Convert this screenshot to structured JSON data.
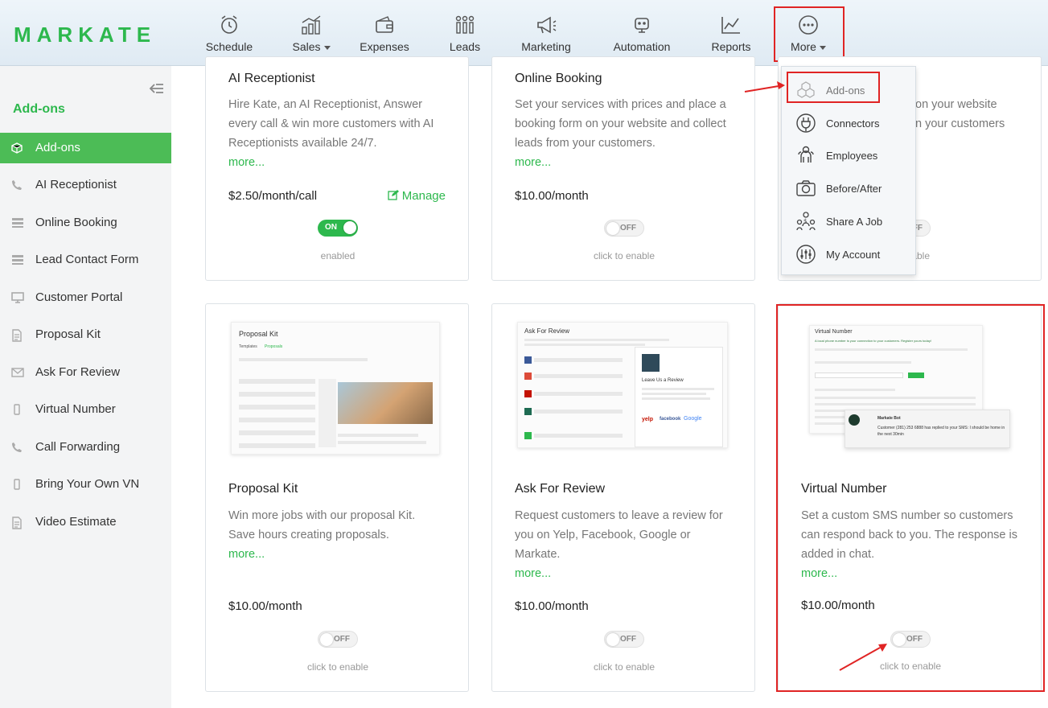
{
  "brand": {
    "name": "MARKATE",
    "accent": "#2db84d",
    "highlight": "#e02424"
  },
  "nav": {
    "schedule": "Schedule",
    "sales": "Sales",
    "expenses": "Expenses",
    "leads": "Leads",
    "marketing": "Marketing",
    "automation": "Automation",
    "reports": "Reports",
    "more": "More"
  },
  "more_menu": {
    "addons": "Add-ons",
    "connectors": "Connectors",
    "employees": "Employees",
    "before_after": "Before/After",
    "share_job": "Share A Job",
    "my_account": "My Account"
  },
  "sidebar": {
    "title": "Add-ons",
    "items": [
      {
        "label": "Add-ons",
        "icon": "cube-icon"
      },
      {
        "label": "AI Receptionist",
        "icon": "phone-icon"
      },
      {
        "label": "Online Booking",
        "icon": "list-icon"
      },
      {
        "label": "Lead Contact Form",
        "icon": "list-icon"
      },
      {
        "label": "Customer Portal",
        "icon": "monitor-icon"
      },
      {
        "label": "Proposal Kit",
        "icon": "document-icon"
      },
      {
        "label": "Ask For Review",
        "icon": "envelope-icon"
      },
      {
        "label": "Virtual Number",
        "icon": "mobile-icon"
      },
      {
        "label": "Call Forwarding",
        "icon": "phone-icon"
      },
      {
        "label": "Bring Your Own VN",
        "icon": "mobile-icon"
      },
      {
        "label": "Video Estimate",
        "icon": "document-icon"
      }
    ]
  },
  "cards": {
    "ai": {
      "title": "AI Receptionist",
      "desc": "Hire Kate, an AI Receptionist, Answer every call & win more customers with AI Receptionists available 24/7.",
      "more": "more...",
      "price": "$2.50/month/call",
      "manage": "Manage",
      "toggle": "ON",
      "caption": "enabled"
    },
    "booking": {
      "title": "Online Booking",
      "desc": "Set your services with prices and place a booking form on your website and collect leads from your customers.",
      "more": "more...",
      "price": "$10.00/month",
      "toggle": "OFF",
      "caption": "click to enable"
    },
    "lead": {
      "desc_line1": "on your website",
      "desc_line2": "n your customers",
      "toggle": "FF",
      "caption": "enable"
    },
    "proposal": {
      "title": "Proposal Kit",
      "desc": "Win more jobs with our proposal Kit. Save hours creating proposals.",
      "more": "more...",
      "price": "$10.00/month",
      "toggle": "OFF",
      "caption": "click to enable",
      "img_title": "Proposal Kit",
      "img_tab1": "Templates",
      "img_tab2": "Proposals"
    },
    "review": {
      "title": "Ask For Review",
      "desc": "Request customers to leave a review for you on Yelp, Facebook, Google or Markate.",
      "more": "more...",
      "price": "$10.00/month",
      "toggle": "OFF",
      "caption": "click to enable",
      "img_title": "Ask For Review",
      "img_leave": "Leave Us a Review"
    },
    "vn": {
      "title": "Virtual Number",
      "desc": "Set a custom SMS number so customers can respond back to you. The response is added in chat.",
      "more": "more...",
      "price": "$10.00/month",
      "toggle": "OFF",
      "caption": "click to enable",
      "img_title": "Virtual Number",
      "img_sub": "A local phone number is your connection to your customers. Register yours today!",
      "img_msg": "Customer (281) 253 6888 has replied to your SMS: I should be home in the next 30min",
      "img_sender": "Markate Bot"
    }
  }
}
